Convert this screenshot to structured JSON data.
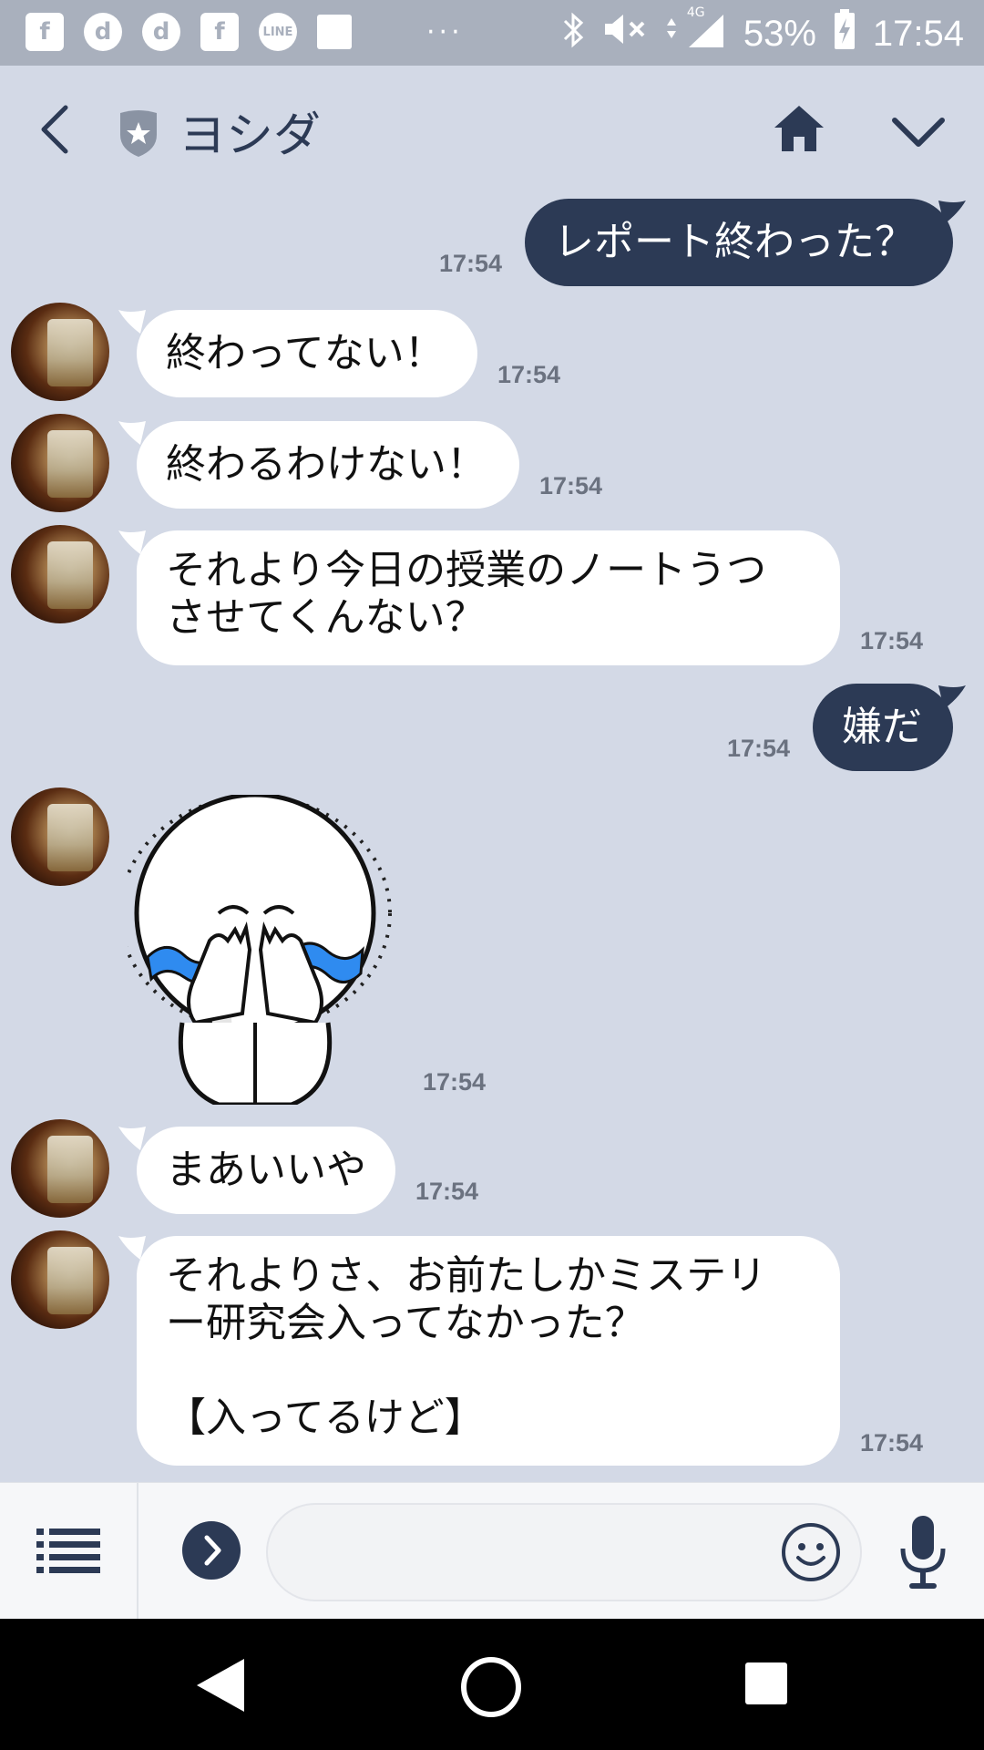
{
  "status_bar": {
    "left_icons": [
      "f",
      "d",
      "d",
      "f",
      "LINE",
      "■"
    ],
    "dots": "···",
    "network": "4G",
    "battery": "53%",
    "time": "17:54"
  },
  "header": {
    "contact_name": "ヨシダ"
  },
  "messages": [
    {
      "id": "m1",
      "side": "out",
      "text": "レポート終わった？",
      "time": "17:54"
    },
    {
      "id": "m2",
      "side": "in",
      "text": "終わってない！",
      "time": "17:54"
    },
    {
      "id": "m3",
      "side": "in",
      "text": "終わるわけない！",
      "time": "17:54"
    },
    {
      "id": "m4",
      "side": "in",
      "text": "それより今日の授業のノートうつ\nさせてくんない？",
      "time": "17:54"
    },
    {
      "id": "m5",
      "side": "out",
      "text": "嫌だ",
      "time": "17:54"
    },
    {
      "id": "m6",
      "side": "in",
      "type": "sticker",
      "sticker": "crying-face-sticker",
      "time": "17:54"
    },
    {
      "id": "m7",
      "side": "in",
      "text": "まあいいや",
      "time": "17:54"
    },
    {
      "id": "m8",
      "side": "in",
      "text": "それよりさ、お前たしかミステリ\nー研究会入ってなかった？\n\n【入ってるけど】",
      "time": "17:54"
    }
  ],
  "input": {
    "value": "",
    "placeholder": ""
  },
  "colors": {
    "chat_background": "#d3d9e6",
    "outgoing_bubble": "#2c3a55",
    "incoming_bubble": "#ffffff",
    "status_bar": "#a9b0bd"
  }
}
